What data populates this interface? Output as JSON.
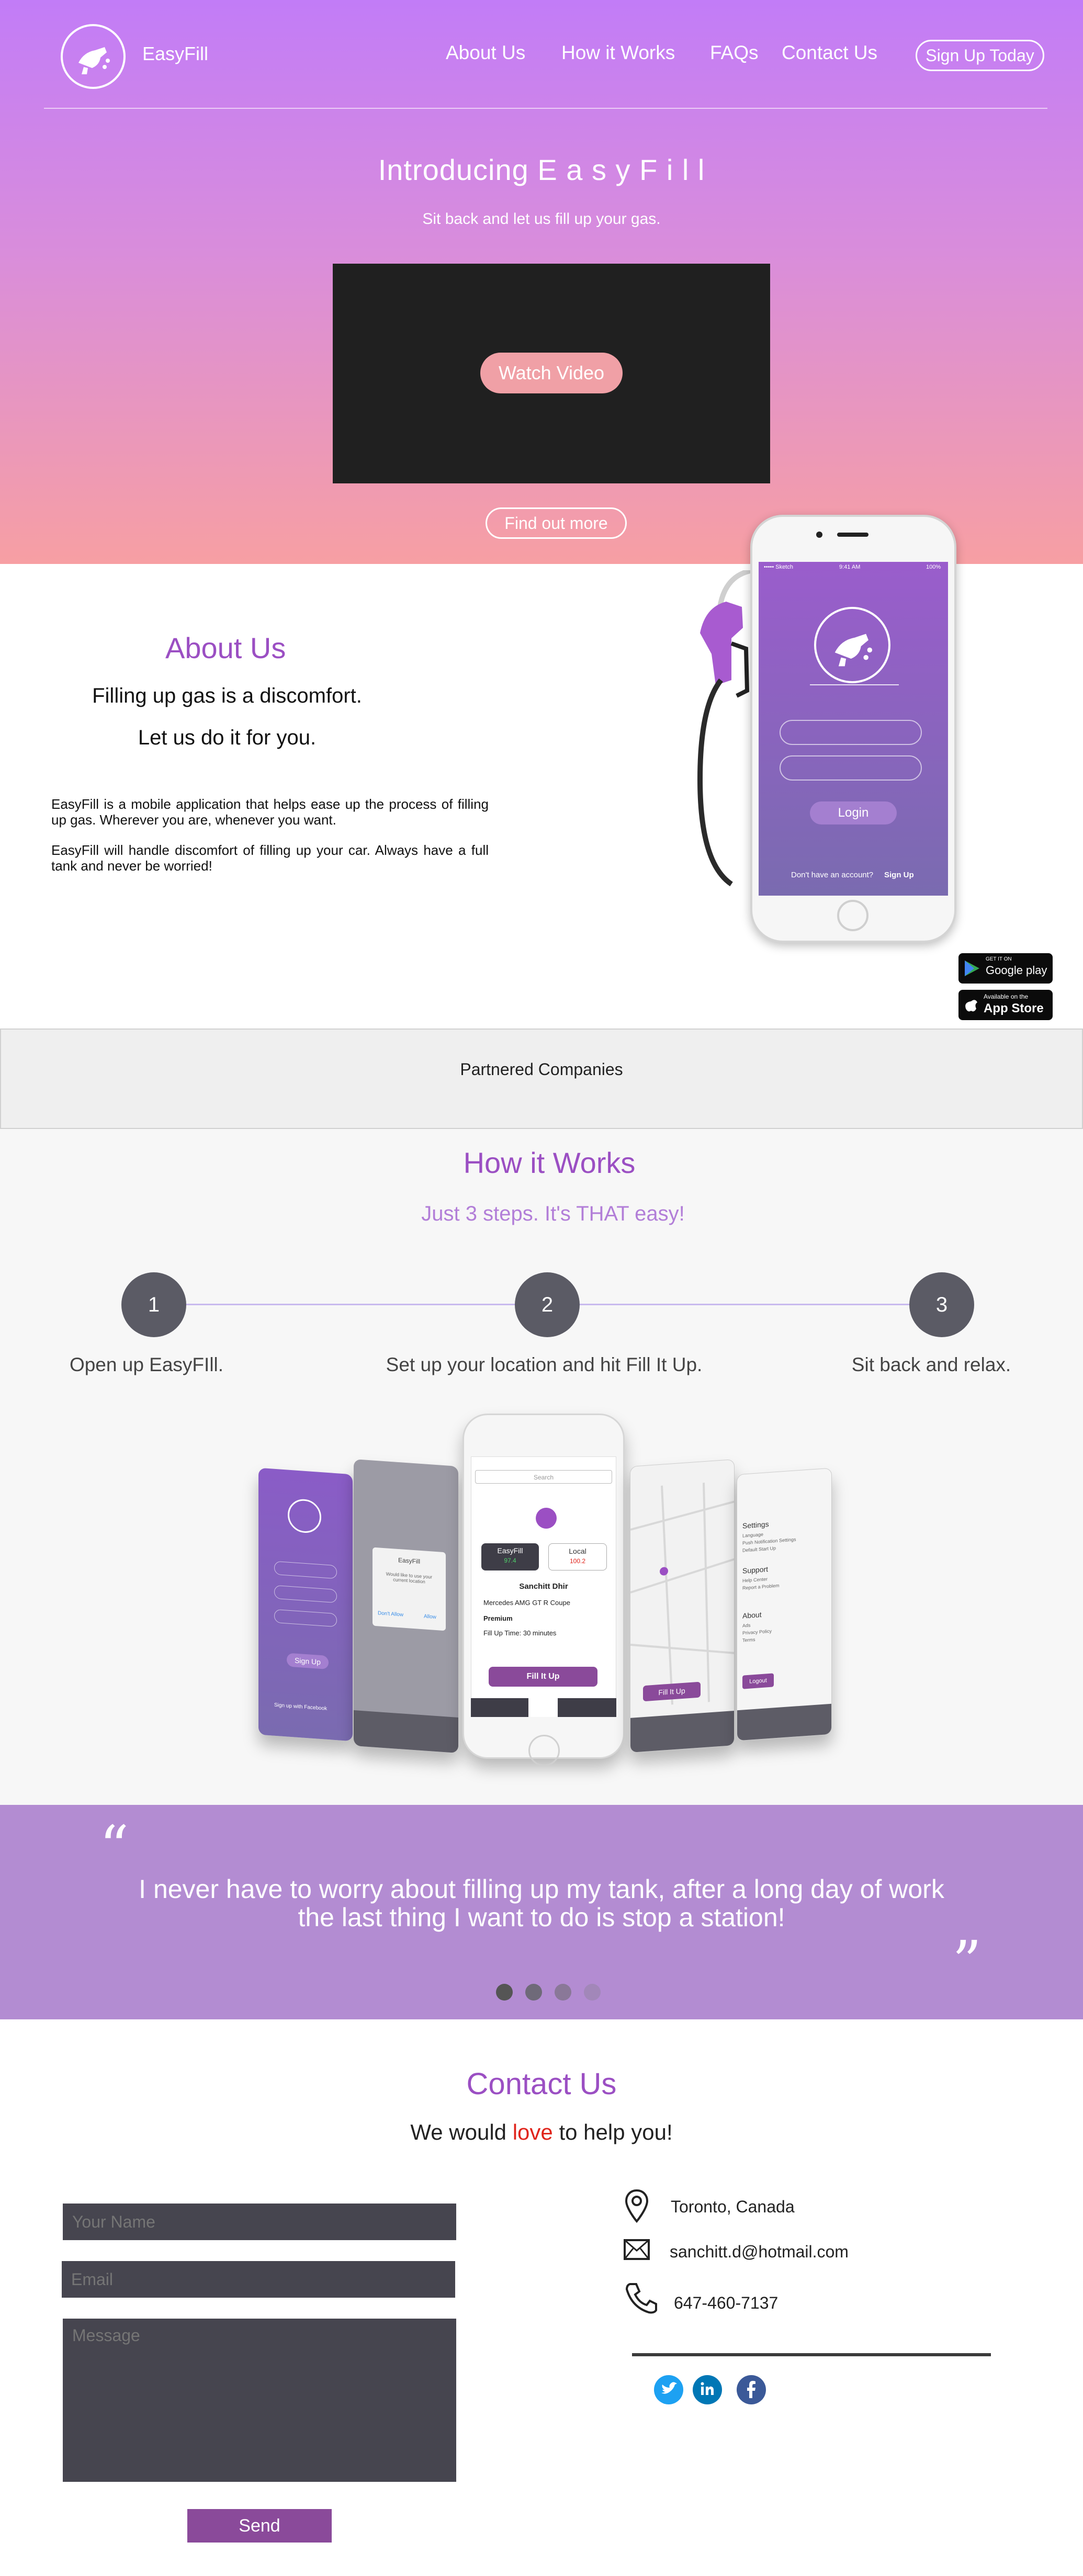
{
  "brand": "EasyFill",
  "nav": [
    "About Us",
    "How it Works",
    "FAQs",
    "Contact Us"
  ],
  "signup_label": "Sign Up Today",
  "hero": {
    "title": "Introducing E a s y F i l l",
    "subtitle": "Sit back and let us fill up your gas.",
    "video_button": "Watch Video",
    "findout_button": "Find out more"
  },
  "about": {
    "title": "About Us",
    "line1": "Filling up gas is a discomfort.",
    "line2": "Let us do it for you.",
    "para1": "EasyFill is a mobile application that helps ease up the process of filling up gas. Wherever you are, whenever you want.",
    "para2": "EasyFill will handle discomfort of filling up your car. Always have a full tank and never be worried!"
  },
  "phone": {
    "status_carrier": "••••• Sketch",
    "status_time": "9:41 AM",
    "status_battery": "100%",
    "login_label": "Login",
    "signup_prompt": "Don't have an account?",
    "signup_link": "Sign Up"
  },
  "stores": {
    "google_small": "GET IT ON",
    "google": "Google play",
    "apple_small": "Available on the",
    "apple": "App Store"
  },
  "partners_label": "Partnered Companies",
  "how": {
    "title": "How it Works",
    "subtitle": "Just 3 steps. It's THAT easy!",
    "steps": [
      {
        "num": "1",
        "text": "Open up EasyFIll."
      },
      {
        "num": "2",
        "text": "Set up your location and hit Fill It Up."
      },
      {
        "num": "3",
        "text": "Sit back and relax."
      }
    ]
  },
  "mock": {
    "easyfill_tab": "EasyFill",
    "easyfill_price": "97.4",
    "local_tab": "Local",
    "local_price": "100.2",
    "driver": "Sanchitt Dhir",
    "car": "Mercedes AMG GT R Coupe",
    "tier": "Premium",
    "filltime": "Fill Up Time: 30 minutes",
    "fill_button": "Fill It Up",
    "search": "Search",
    "dialog_title": "EasyFill",
    "dialog_text": "Would like to use your current location",
    "dialog_deny": "Don't Allow",
    "dialog_allow": "Allow",
    "signup_btn": "Sign Up",
    "facebook": "Sign up with Facebook",
    "settings_title": "Settings",
    "settings_items": [
      "Language",
      "Push Notification Settings",
      "Default Start Up"
    ],
    "support_title": "Support",
    "support_items": [
      "Help Center",
      "Report a Problem"
    ],
    "about_title": "About",
    "about_items": [
      "Ads",
      "Privacy Policy",
      "Terms"
    ],
    "logout": "Logout",
    "fill_small": "Fill It Up"
  },
  "quote": {
    "open": "“",
    "text": "I never have to worry about filling up my tank, after a long day of work the last thing I want to do is stop a station!",
    "close": "”",
    "dots": 4,
    "active_dot": 0
  },
  "contact": {
    "title": "Contact Us",
    "sub_before": "We would ",
    "sub_love": "love",
    "sub_after": " to help you!",
    "name_placeholder": "Your Name",
    "email_placeholder": "Email",
    "message_placeholder": "Message",
    "send_label": "Send",
    "location": "Toronto, Canada",
    "email": "sanchitt.d@hotmail.com",
    "phone": "647-460-7137"
  },
  "colors": {
    "purple": "#9b4fc3",
    "quote_bg": "#b38cd2",
    "field_bg": "#46454f",
    "send_bg": "#8a4a9a",
    "love": "#e0241b"
  },
  "icons": [
    "fuel-nozzle-icon",
    "location-pin-icon",
    "envelope-icon",
    "phone-icon",
    "twitter-icon",
    "linkedin-icon",
    "facebook-icon",
    "google-play-icon",
    "apple-icon"
  ]
}
